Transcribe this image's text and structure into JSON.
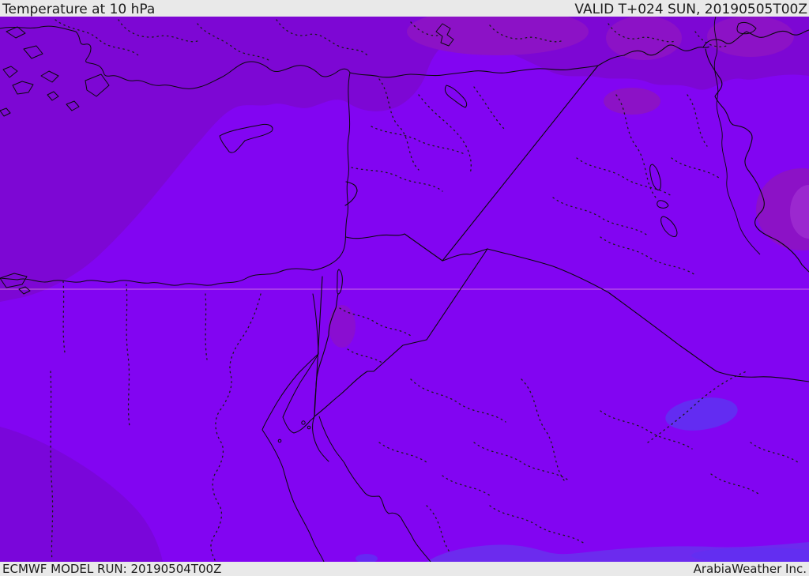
{
  "header": {
    "title": "Temperature at 10 hPa",
    "valid_time": "VALID T+024 SUN, 20190505T00Z"
  },
  "footer": {
    "model_run": "ECMWF MODEL RUN: 20190504T00Z",
    "attribution": "ArabiaWeather Inc."
  },
  "map": {
    "kind": "weather-model-temperature-field",
    "region": "Eastern Mediterranean / Middle East",
    "colors": {
      "bar_bg": "#e9e9e9",
      "bar_text": "#1c1c1c",
      "temp_main": "#8205f2",
      "temp_cool_band_north": "#7d07d4",
      "temp_cool_sw": "#7a06da",
      "temp_warm_blob": "#8c12c6",
      "temp_warm_core": "#9b28cf",
      "temp_cold_patch": "#5f31f2",
      "temp_cold_band_south": "#6c2bee",
      "coastline": "#0a0a0a",
      "admin": "#1a1a1a",
      "graticule": "#efa3dd"
    }
  }
}
